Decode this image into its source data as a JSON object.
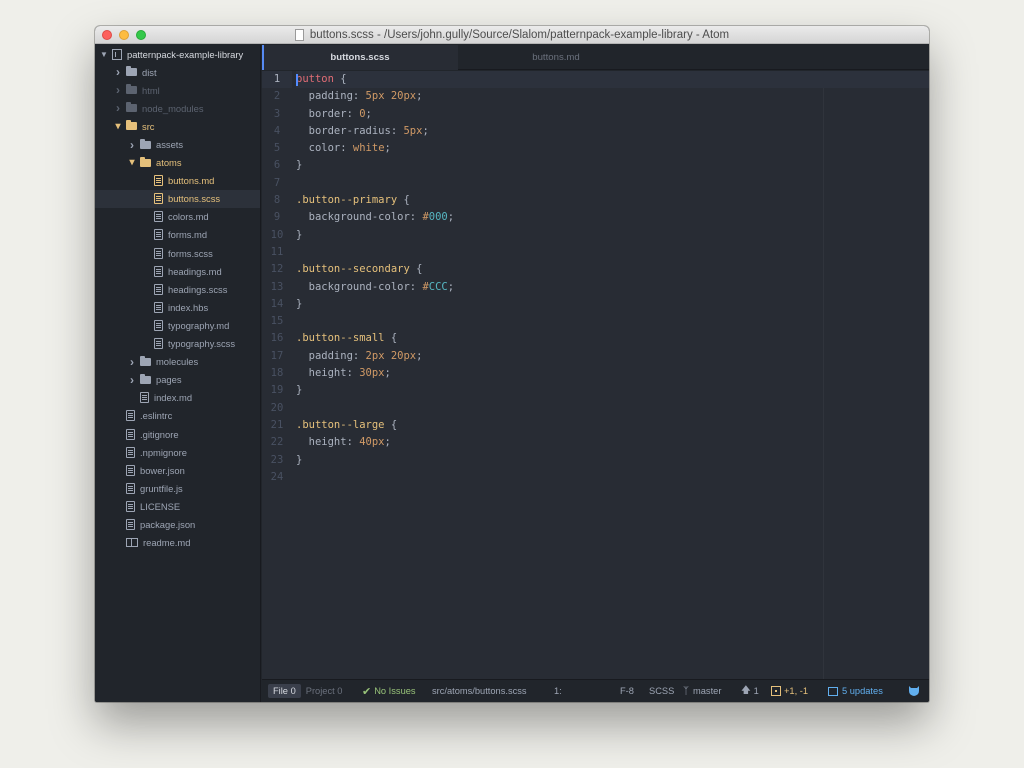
{
  "window": {
    "title": "buttons.scss - /Users/john.gully/Source/Slalom/patternpack-example-library - Atom"
  },
  "tree": {
    "project": "patternpack-example-library",
    "items": [
      {
        "label": "dist",
        "kind": "folder",
        "depth": 1,
        "expanded": false,
        "state": "normal"
      },
      {
        "label": "html",
        "kind": "folder",
        "depth": 1,
        "expanded": false,
        "state": "ignored"
      },
      {
        "label": "node_modules",
        "kind": "folder",
        "depth": 1,
        "expanded": false,
        "state": "ignored"
      },
      {
        "label": "src",
        "kind": "folder",
        "depth": 1,
        "expanded": true,
        "state": "modified"
      },
      {
        "label": "assets",
        "kind": "folder",
        "depth": 2,
        "expanded": false,
        "state": "normal"
      },
      {
        "label": "atoms",
        "kind": "folder",
        "depth": 2,
        "expanded": true,
        "state": "modified"
      },
      {
        "label": "buttons.md",
        "kind": "file",
        "depth": 3,
        "state": "modified"
      },
      {
        "label": "buttons.scss",
        "kind": "file",
        "depth": 3,
        "state": "selected"
      },
      {
        "label": "colors.md",
        "kind": "file",
        "depth": 3,
        "state": "normal"
      },
      {
        "label": "forms.md",
        "kind": "file",
        "depth": 3,
        "state": "normal"
      },
      {
        "label": "forms.scss",
        "kind": "file",
        "depth": 3,
        "state": "normal"
      },
      {
        "label": "headings.md",
        "kind": "file",
        "depth": 3,
        "state": "normal"
      },
      {
        "label": "headings.scss",
        "kind": "file",
        "depth": 3,
        "state": "normal"
      },
      {
        "label": "index.hbs",
        "kind": "file",
        "depth": 3,
        "state": "normal"
      },
      {
        "label": "typography.md",
        "kind": "file",
        "depth": 3,
        "state": "normal"
      },
      {
        "label": "typography.scss",
        "kind": "file",
        "depth": 3,
        "state": "normal"
      },
      {
        "label": "molecules",
        "kind": "folder",
        "depth": 2,
        "expanded": false,
        "state": "normal"
      },
      {
        "label": "pages",
        "kind": "folder",
        "depth": 2,
        "expanded": false,
        "state": "normal"
      },
      {
        "label": "index.md",
        "kind": "file",
        "depth": 2,
        "state": "normal"
      },
      {
        "label": ".eslintrc",
        "kind": "file",
        "depth": 1,
        "state": "normal"
      },
      {
        "label": ".gitignore",
        "kind": "file",
        "depth": 1,
        "state": "normal"
      },
      {
        "label": ".npmignore",
        "kind": "file",
        "depth": 1,
        "state": "normal"
      },
      {
        "label": "bower.json",
        "kind": "file",
        "depth": 1,
        "state": "normal"
      },
      {
        "label": "gruntfile.js",
        "kind": "file",
        "depth": 1,
        "state": "normal"
      },
      {
        "label": "LICENSE",
        "kind": "file",
        "depth": 1,
        "state": "normal"
      },
      {
        "label": "package.json",
        "kind": "file",
        "depth": 1,
        "state": "normal"
      },
      {
        "label": "readme.md",
        "kind": "book",
        "depth": 1,
        "state": "normal"
      }
    ]
  },
  "tabs": [
    {
      "label": "buttons.scss",
      "active": true
    },
    {
      "label": "buttons.md",
      "active": false
    }
  ],
  "editor": {
    "current_line": 1,
    "lines": [
      [
        {
          "t": "button",
          "c": "sel"
        },
        {
          "t": " {",
          "c": "punc"
        }
      ],
      [
        {
          "t": "  padding: ",
          "c": "prop"
        },
        {
          "t": "5px 20px",
          "c": "num"
        },
        {
          "t": ";",
          "c": "punc"
        }
      ],
      [
        {
          "t": "  border: ",
          "c": "prop"
        },
        {
          "t": "0",
          "c": "num"
        },
        {
          "t": ";",
          "c": "punc"
        }
      ],
      [
        {
          "t": "  border-radius: ",
          "c": "prop"
        },
        {
          "t": "5px",
          "c": "num"
        },
        {
          "t": ";",
          "c": "punc"
        }
      ],
      [
        {
          "t": "  color: ",
          "c": "prop"
        },
        {
          "t": "white",
          "c": "val"
        },
        {
          "t": ";",
          "c": "punc"
        }
      ],
      [
        {
          "t": "}",
          "c": "punc"
        }
      ],
      [],
      [
        {
          "t": ".button--primary",
          "c": "cls"
        },
        {
          "t": " {",
          "c": "punc"
        }
      ],
      [
        {
          "t": "  background-color: ",
          "c": "prop"
        },
        {
          "t": "#",
          "c": "hash"
        },
        {
          "t": "000",
          "c": "hex"
        },
        {
          "t": ";",
          "c": "punc"
        }
      ],
      [
        {
          "t": "}",
          "c": "punc"
        }
      ],
      [],
      [
        {
          "t": ".button--secondary",
          "c": "cls"
        },
        {
          "t": " {",
          "c": "punc"
        }
      ],
      [
        {
          "t": "  background-color: ",
          "c": "prop"
        },
        {
          "t": "#",
          "c": "hash"
        },
        {
          "t": "CCC",
          "c": "hex"
        },
        {
          "t": ";",
          "c": "punc"
        }
      ],
      [
        {
          "t": "}",
          "c": "punc"
        }
      ],
      [],
      [
        {
          "t": ".button--small",
          "c": "cls"
        },
        {
          "t": " {",
          "c": "punc"
        }
      ],
      [
        {
          "t": "  padding: ",
          "c": "prop"
        },
        {
          "t": "2px 20px",
          "c": "num"
        },
        {
          "t": ";",
          "c": "punc"
        }
      ],
      [
        {
          "t": "  height: ",
          "c": "prop"
        },
        {
          "t": "30px",
          "c": "num"
        },
        {
          "t": ";",
          "c": "punc"
        }
      ],
      [
        {
          "t": "}",
          "c": "punc"
        }
      ],
      [],
      [
        {
          "t": ".button--large",
          "c": "cls"
        },
        {
          "t": " {",
          "c": "punc"
        }
      ],
      [
        {
          "t": "  height: ",
          "c": "prop"
        },
        {
          "t": "40px",
          "c": "num"
        },
        {
          "t": ";",
          "c": "punc"
        }
      ],
      [
        {
          "t": "}",
          "c": "punc"
        }
      ],
      []
    ]
  },
  "status": {
    "file_label": "File",
    "file_count": "0",
    "project_label": "Project",
    "project_count": "0",
    "issues": "No Issues",
    "path": "src/atoms/buttons.scss",
    "cursor": "1:",
    "encoding": "F-8",
    "grammar": "SCSS",
    "branch": "master",
    "ahead": "1",
    "diff": "+1, -1",
    "updates": "5 updates"
  },
  "colors": {
    "accent": "#568af2",
    "modified": "#e5c07b",
    "ok": "#98c379",
    "updates": "#61afef"
  },
  "icons": {
    "project": "repo-icon",
    "folder": "folder-icon",
    "file": "file-text-icon",
    "readme": "book-icon",
    "check": "check-icon",
    "branch": "git-branch-icon",
    "ahead": "arrow-up-icon",
    "diff": "diff-icon",
    "updates": "package-icon",
    "octocat": "octocat-icon"
  }
}
